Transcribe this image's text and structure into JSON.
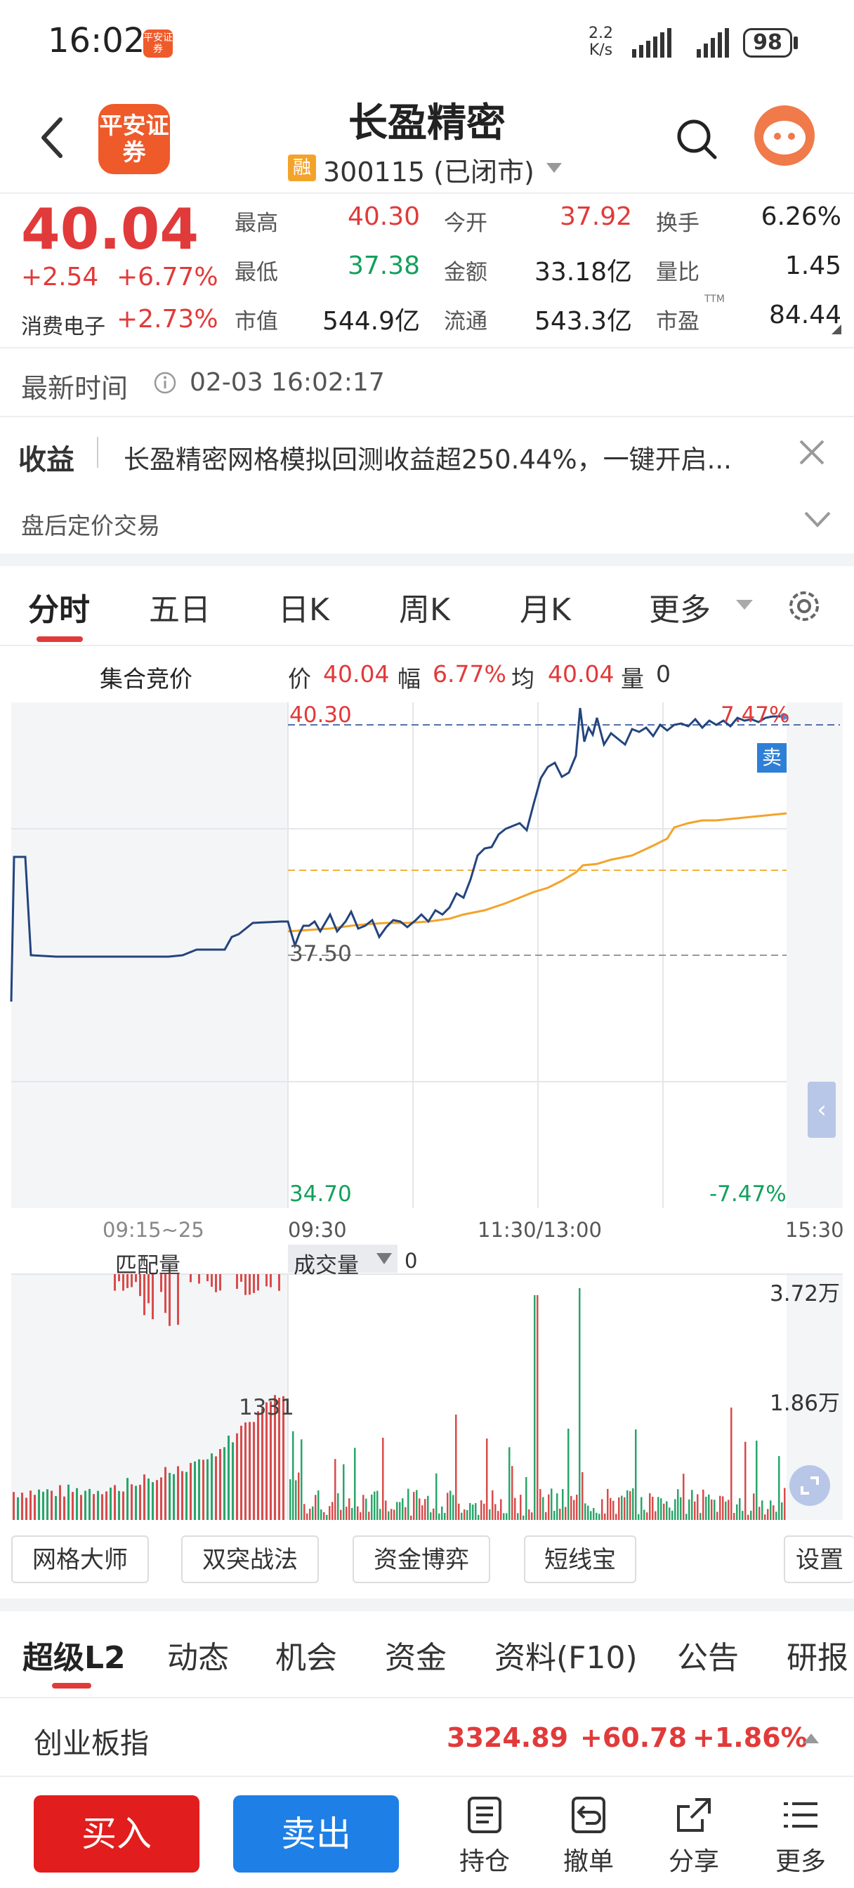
{
  "status": {
    "time": "16:02",
    "app_badge": "平安证券",
    "net_speed": "2.2",
    "net_unit": "K/s",
    "battery": "98"
  },
  "header": {
    "logo": "平安证券",
    "name": "长盈精密",
    "tag": "融",
    "code": "300115 (已闭市)"
  },
  "quote": {
    "price": "40.04",
    "change": "+2.54",
    "change_pct": "+6.77%",
    "sector": "消费电子",
    "sector_pct": "+2.73%",
    "stats": [
      {
        "label": "最高",
        "value": "40.30"
      },
      {
        "label": "今开",
        "value": "37.92"
      },
      {
        "label": "换手",
        "value": "6.26%"
      },
      {
        "label": "最低",
        "value": "37.38"
      },
      {
        "label": "金额",
        "value": "33.18亿"
      },
      {
        "label": "量比",
        "value": "1.45"
      },
      {
        "label": "市值",
        "value": "544.9亿"
      },
      {
        "label": "流通",
        "value": "543.3亿"
      },
      {
        "label": "市盈",
        "value": "84.44"
      }
    ],
    "ttm": "TTM"
  },
  "update": {
    "label": "最新时间",
    "time": "02-03 16:02:17"
  },
  "banner": {
    "title": "收益",
    "text": "长盈精密网格模拟回测收益超250.44%，一键开启..."
  },
  "afterhours": {
    "label": "盘后定价交易"
  },
  "chart_tabs": [
    "分时",
    "五日",
    "日K",
    "周K",
    "月K",
    "更多"
  ],
  "chart_info": {
    "auction": "集合竞价",
    "price_l": "价",
    "price": "40.04",
    "amp_l": "幅",
    "amp": "6.77%",
    "avg_l": "均",
    "avg": "40.04",
    "vol_l": "量",
    "vol": "0"
  },
  "chart_data": {
    "type": "line",
    "price_top": "40.30",
    "price_mid": "37.50",
    "price_bot": "34.70",
    "pct_top": "7.47%",
    "pct_bot": "-7.47%",
    "sell_tag": "卖",
    "x_labels": [
      "09:15~25",
      "09:30",
      "11:30/13:00",
      "15:30"
    ],
    "vol_label_left": "匹配量",
    "vol_label_sel": "成交量",
    "vol_value": "0",
    "vol_top": "3.72万",
    "vol_mid": "1.86万",
    "auction_vol": "1331"
  },
  "tools": [
    "网格大师",
    "双突战法",
    "资金博弈",
    "短线宝",
    "设置"
  ],
  "navtabs": [
    "超级L2",
    "动态",
    "机会",
    "资金",
    "资料(F10)",
    "公告",
    "研报"
  ],
  "index": {
    "name": "创业板指",
    "value": "3324.89",
    "change": "+60.78",
    "pct": "+1.86%"
  },
  "bottom": {
    "buy": "买入",
    "sell": "卖出",
    "items": [
      "持仓",
      "撤单",
      "分享",
      "更多"
    ]
  }
}
